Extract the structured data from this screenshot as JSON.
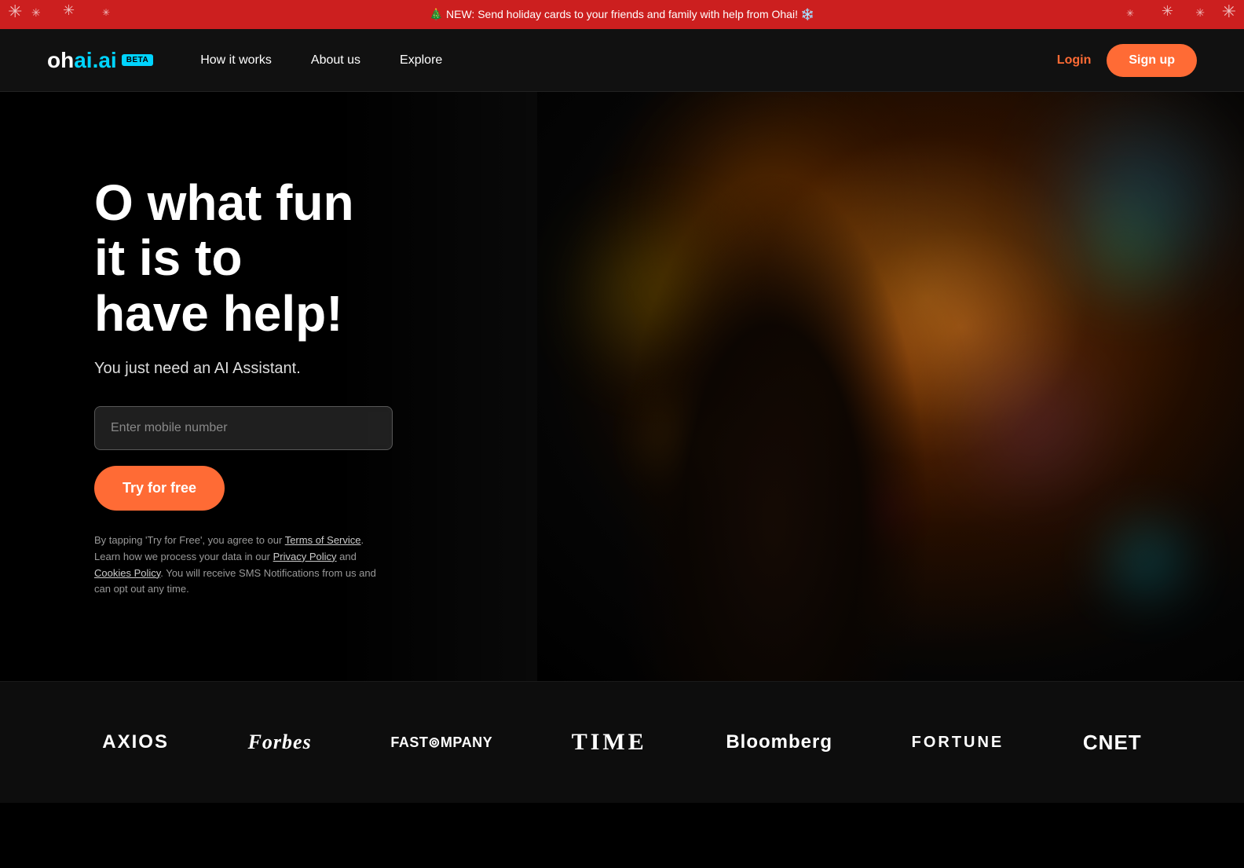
{
  "banner": {
    "text": "🎄 NEW: Send holiday cards to your friends and family with help from Ohai! ❄️"
  },
  "nav": {
    "logo": "ohai",
    "logo_suffix": ".ai",
    "beta": "BETA",
    "links": [
      {
        "label": "How it works",
        "id": "how-it-works"
      },
      {
        "label": "About us",
        "id": "about-us"
      },
      {
        "label": "Explore",
        "id": "explore"
      }
    ],
    "login": "Login",
    "signup": "Sign up"
  },
  "hero": {
    "title_line1": "O what fun it is to",
    "title_line2": "have help!",
    "subtitle": "You just need an AI Assistant.",
    "input_placeholder": "Enter mobile number",
    "cta_button": "Try for free",
    "terms": "By tapping 'Try for Free', you agree to our ",
    "terms_link1": "Terms of Service",
    "terms_mid1": ". Learn how we process your data in our ",
    "terms_link2": "Privacy Policy",
    "terms_mid2": " and ",
    "terms_link3": "Cookies Policy",
    "terms_end": ". You will receive SMS Notifications from us and can opt out any time."
  },
  "press": {
    "logos": [
      {
        "name": "AXIOS",
        "class": "axios"
      },
      {
        "name": "Forbes",
        "class": "forbes"
      },
      {
        "name": "FAST COMPANY",
        "class": "fastco",
        "display": "FAST⊚MPANY"
      },
      {
        "name": "TIME",
        "class": "time"
      },
      {
        "name": "Bloomberg",
        "class": "bloomberg"
      },
      {
        "name": "FORTUNE",
        "class": "fortune"
      },
      {
        "name": "CNET",
        "class": "cnet"
      }
    ]
  }
}
